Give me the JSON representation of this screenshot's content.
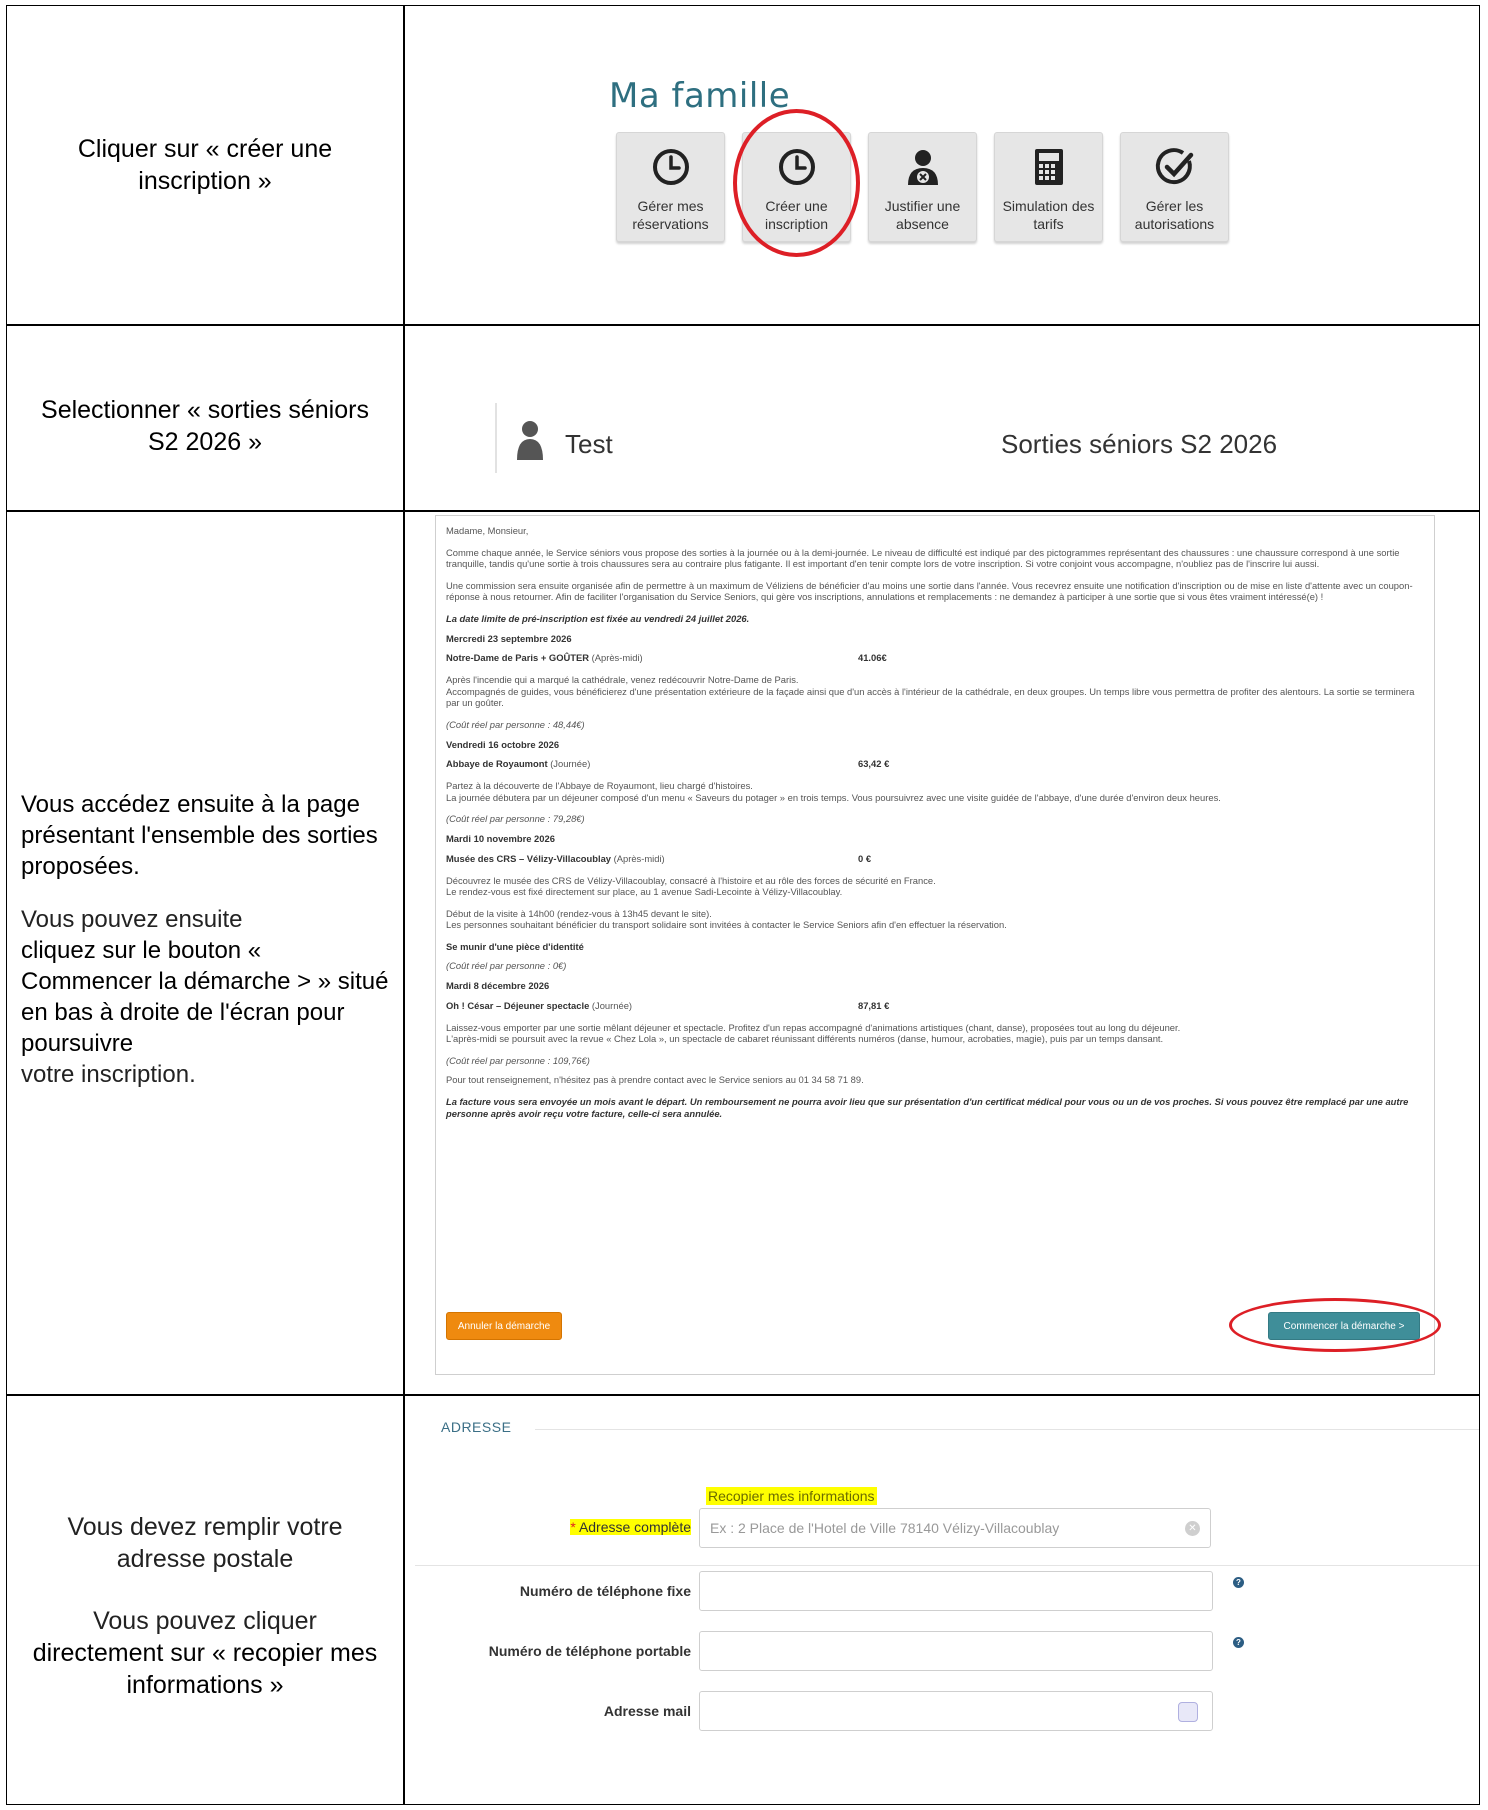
{
  "rows": {
    "r1": {
      "instruction": "Cliquer sur « créer une inscription »",
      "title": "Ma famille",
      "tiles": [
        {
          "label": "Gérer mes réservations",
          "icon": "clock-icon"
        },
        {
          "label": "Créer une inscription",
          "icon": "clock-icon"
        },
        {
          "label": "Justifier une absence",
          "icon": "person-x-icon"
        },
        {
          "label": "Simulation des tarifs",
          "icon": "calculator-icon"
        },
        {
          "label": "Gérer les autorisations",
          "icon": "check-circle-icon"
        }
      ]
    },
    "r2": {
      "instruction": "Selectionner « sorties séniors S2 2026 »",
      "person": "Test",
      "activity": "Sorties séniors S2 2026"
    },
    "r3": {
      "instruction_bold": "Vous accédez ensuite à la page présentant l'ensemble des sorties proposées.",
      "instruction_light_1": "Vous pouvez ensuite",
      "instruction_bold_2": "cliquez sur le bouton « Commencer la démarche > » situé en bas à droite de l'écran pour poursuivre",
      "instruction_light_2": "votre inscription.",
      "doc": {
        "greeting": "Madame, Monsieur,",
        "intro1": "Comme chaque année, le Service séniors vous propose des sorties à la journée ou à la demi-journée. Le niveau de difficulté est indiqué par des pictogrammes représentant des chaussures : une chaussure correspond à une sortie tranquille, tandis qu'une sortie à trois chaussures sera au contraire plus fatigante. Il est important d'en tenir compte lors de votre inscription. Si votre conjoint vous accompagne, n'oubliez pas de l'inscrire lui aussi.",
        "intro2": "Une commission sera ensuite organisée afin de permettre à un maximum de Véliziens de bénéficier d'au moins une sortie dans l'année. Vous recevrez ensuite une notification d'inscription ou de mise en liste d'attente avec un coupon-réponse à nous retourner. Afin de faciliter l'organisation du Service Seniors, qui gère vos inscriptions, annulations et remplacements : ne demandez à participer à une sortie que si vous êtes vraiment intéressé(e) !",
        "deadline": "La date limite de pré-inscription est fixée au vendredi 24 juillet 2026.",
        "events": [
          {
            "date": "Mercredi 23 septembre 2026",
            "name": "Notre-Dame de Paris + GOÛTER",
            "when": "(Après-midi)",
            "price": "41.06€",
            "desc": [
              "Après l'incendie qui a marqué la cathédrale, venez redécouvrir Notre-Dame de Paris.",
              "Accompagnés de guides, vous bénéficierez d'une présentation extérieure de la façade ainsi que d'un accès à l'intérieur de la cathédrale, en deux groupes. Un temps libre vous permettra de profiter des alentours. La sortie se terminera par un goûter."
            ],
            "cost": "(Coût réel par personne :  48,44€)"
          },
          {
            "date": "Vendredi 16 octobre 2026",
            "name": "Abbaye de Royaumont",
            "when": "(Journée)",
            "price": "63,42 €",
            "desc": [
              "Partez à la découverte de l'Abbaye de Royaumont, lieu chargé d'histoires.",
              "La journée débutera par un déjeuner composé d'un menu « Saveurs du potager » en trois temps. Vous poursuivrez avec une visite guidée de l'abbaye, d'une durée d'environ deux heures."
            ],
            "cost": "(Coût réel par personne : 79,28€)"
          },
          {
            "date": "Mardi 10 novembre 2026",
            "name": "Musée des CRS – Vélizy-Villacoublay",
            "when": "(Après-midi)",
            "price": "0 €",
            "desc": [
              "Découvrez le musée des CRS de Vélizy-Villacoublay, consacré à l'histoire et au rôle des forces de sécurité en France.",
              "Le rendez-vous est fixé directement sur place, au 1 avenue Sadi-Lecointe à Vélizy-Villacoublay."
            ],
            "desc2": [
              "Début de la visite à 14h00 (rendez-vous à 13h45 devant le site).",
              "Les personnes souhaitant bénéficier du transport solidaire sont invitées à contacter le Service Seniors afin d'en effectuer la réservation."
            ],
            "note": "Se munir d'une pièce d'identité",
            "cost": "(Coût réel par personne :  0€)"
          },
          {
            "date": "Mardi 8 décembre 2026",
            "name": "Oh ! César – Déjeuner spectacle",
            "when": "(Journée)",
            "price": "87,81 €",
            "desc": [
              "Laissez-vous emporter par une sortie mêlant déjeuner et spectacle. Profitez d'un repas accompagné d'animations artistiques (chant, danse), proposées tout au long du déjeuner.",
              "L'après-midi se poursuit avec la revue « Chez Lola », un spectacle de cabaret réunissant différents numéros (danse, humour, acrobaties, magie), puis par un temps dansant."
            ],
            "cost": "(Coût réel par personne :  109,76€)"
          }
        ],
        "contact": "Pour tout renseignement, n'hésitez pas à prendre contact avec le Service seniors au 01 34 58 71 89.",
        "footer": "La facture vous sera envoyée un mois avant le départ. Un remboursement ne pourra avoir lieu que sur présentation d'un certificat médical pour vous ou un de vos proches. Si vous pouvez être remplacé par une autre personne après avoir reçu votre facture, celle-ci sera annulée.",
        "cancel_label": "Annuler la démarche",
        "start_label": "Commencer la démarche >"
      }
    },
    "r4": {
      "instruction1": "Vous devez remplir votre adresse postale",
      "instruction2_light": "Vous pouvez cliquer",
      "instruction2_bold": "directement sur « recopier mes informations »",
      "legend": "ADRESSE",
      "copy_link": "Recopier mes informations",
      "star": "*",
      "address_label": "Adresse complète",
      "address_placeholder": "Ex : 2 Place de l'Hotel de Ville 78140 Vélizy-Villacoublay",
      "phone_fixed_label": "Numéro de téléphone fixe",
      "phone_mobile_label": "Numéro de téléphone portable",
      "email_label": "Adresse mail"
    }
  },
  "colors": {
    "accent": "#2e6f80",
    "red": "#dd1f26",
    "cancel": "#ef8a0f",
    "start": "#3f8e99",
    "highlight": "#ffff00"
  }
}
